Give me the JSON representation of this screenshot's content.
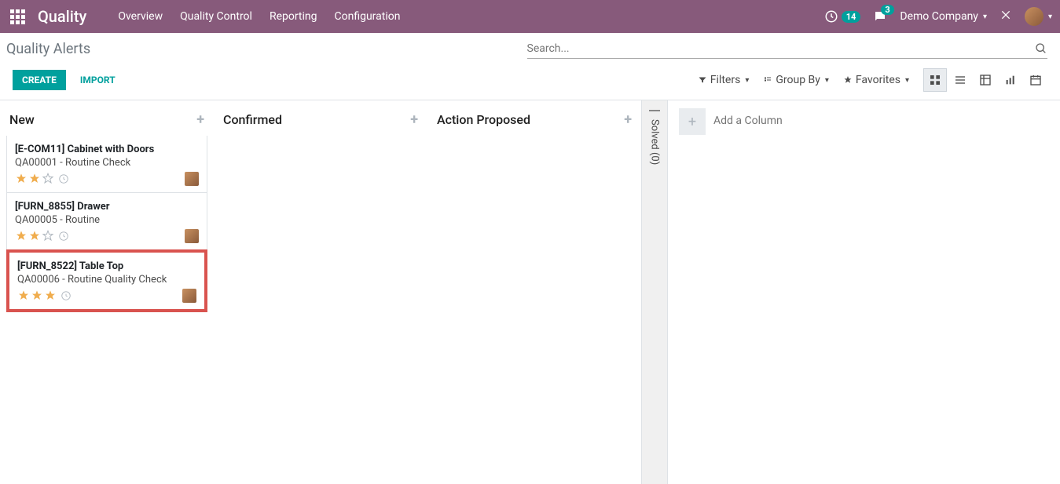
{
  "navbar": {
    "brand": "Quality",
    "menu": [
      "Overview",
      "Quality Control",
      "Reporting",
      "Configuration"
    ],
    "timer_badge": "14",
    "chat_badge": "3",
    "company": "Demo Company"
  },
  "control_panel": {
    "breadcrumb": "Quality Alerts",
    "search_placeholder": "Search...",
    "create_label": "CREATE",
    "import_label": "IMPORT",
    "filters_label": "Filters",
    "groupby_label": "Group By",
    "favorites_label": "Favorites"
  },
  "kanban": {
    "columns": [
      {
        "title": "New",
        "cards": [
          {
            "title": "[E-COM11] Cabinet with Doors",
            "sub": "QA00001 - Routine Check",
            "stars": 2,
            "highlighted": false
          },
          {
            "title": "[FURN_8855] Drawer",
            "sub": "QA00005 - Routine",
            "stars": 2,
            "highlighted": false
          },
          {
            "title": "[FURN_8522] Table Top",
            "sub": "QA00006 - Routine Quality Check",
            "stars": 3,
            "highlighted": true
          }
        ]
      },
      {
        "title": "Confirmed",
        "cards": []
      },
      {
        "title": "Action Proposed",
        "cards": []
      }
    ],
    "folded": {
      "title": "Solved (0)"
    },
    "add_column_placeholder": "Add a Column"
  }
}
